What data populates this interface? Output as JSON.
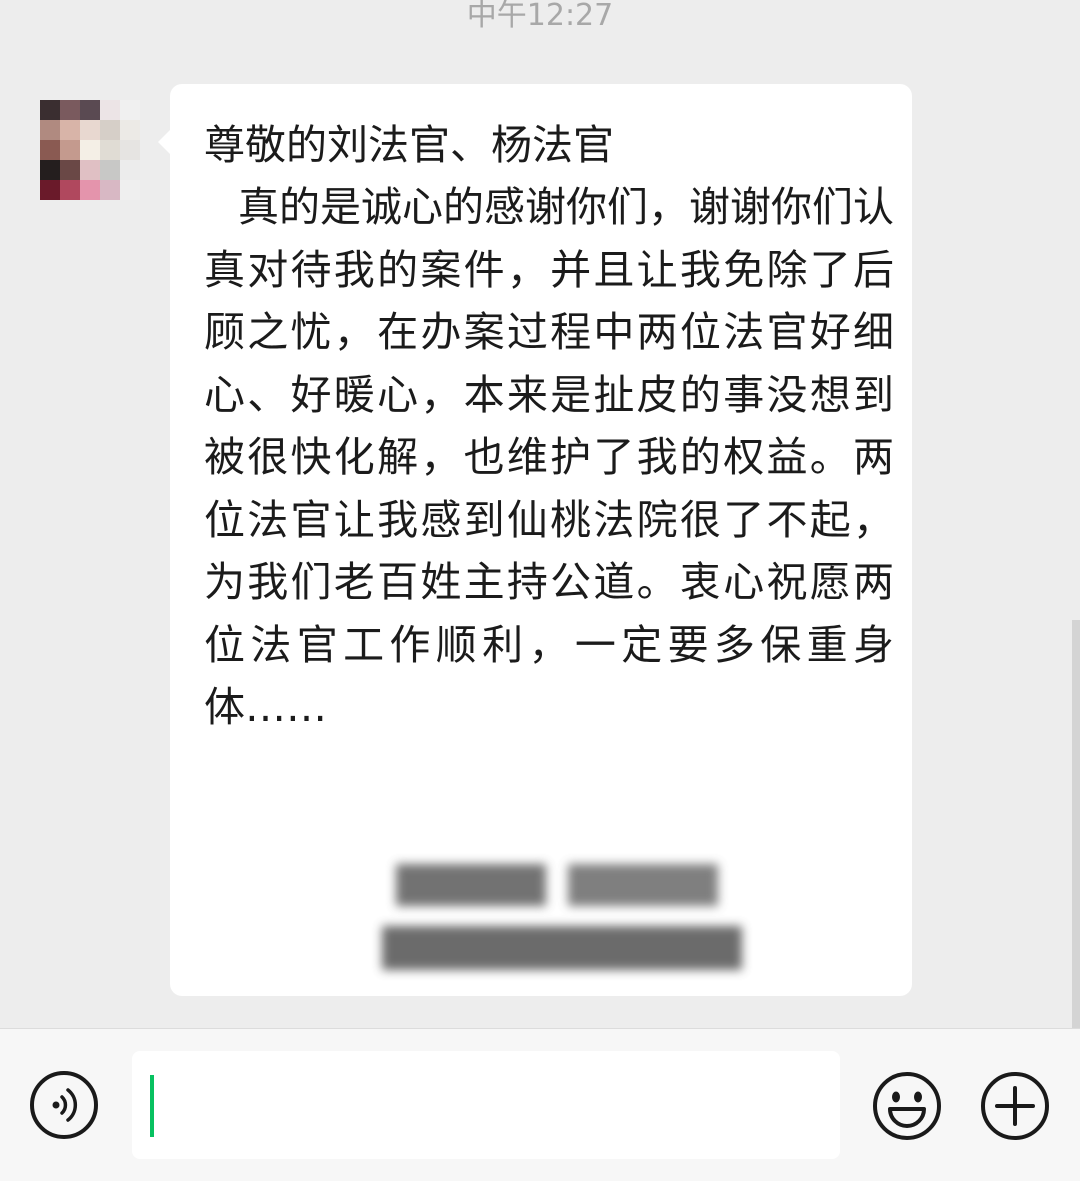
{
  "chat": {
    "timestamp": "中午12:27",
    "contact": {
      "avatar_icon": "pixelated-avatar"
    },
    "message": {
      "salutation": "尊敬的刘法官、杨法官",
      "body": "真的是诚心的感谢你们，谢谢你们认真对待我的案件，并且让我免除了后顾之忧，在办案过程中两位法官好细心、好暖心，本来是扯皮的事没想到被很快化解，也维护了我的权益。两位法官让我感到仙桃法院很了不起，为我们老百姓主持公道。衷心祝愿两位法官工作顺利，一定要多保重身体……",
      "signature": {
        "line1": "",
        "line2": ""
      }
    }
  },
  "input_bar": {
    "voice_icon": "voice-icon",
    "text_value": "",
    "emoji_icon": "emoji-icon",
    "more_icon": "plus-icon",
    "caret_color": "#07c160"
  },
  "colors": {
    "background": "#ededed",
    "bubble": "#ffffff",
    "accent": "#07c160"
  }
}
